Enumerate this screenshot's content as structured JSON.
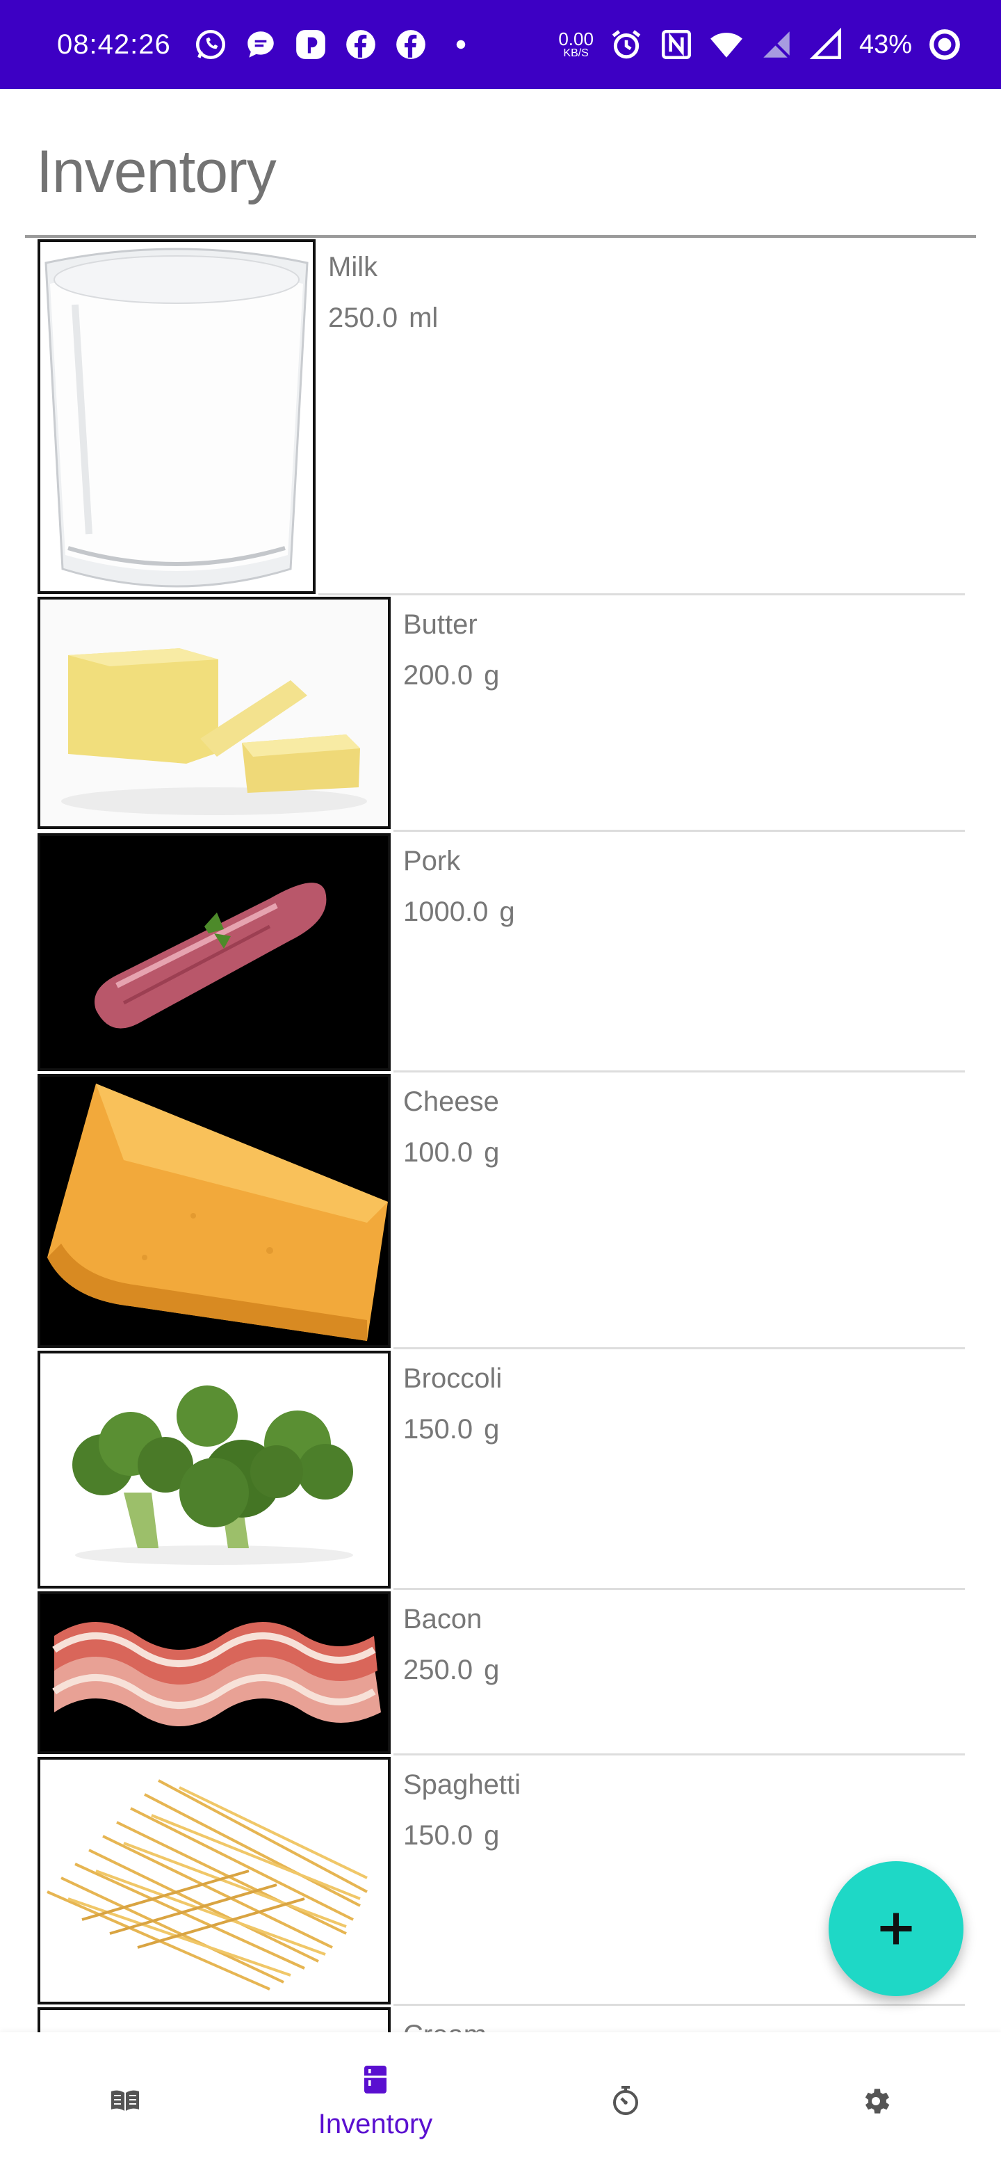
{
  "status_bar": {
    "time": "08:42:26",
    "netspeed_value": "0.00",
    "netspeed_unit": "KB/S",
    "battery_percent": "43%"
  },
  "page": {
    "title": "Inventory"
  },
  "inventory": {
    "items": [
      {
        "name": "Milk",
        "amount": "250.0",
        "unit": "ml"
      },
      {
        "name": "Butter",
        "amount": "200.0",
        "unit": "g"
      },
      {
        "name": "Pork",
        "amount": "1000.0",
        "unit": "g"
      },
      {
        "name": "Cheese",
        "amount": "100.0",
        "unit": "g"
      },
      {
        "name": "Broccoli",
        "amount": "150.0",
        "unit": "g"
      },
      {
        "name": "Bacon",
        "amount": "250.0",
        "unit": "g"
      },
      {
        "name": "Spaghetti",
        "amount": "150.0",
        "unit": "g"
      },
      {
        "name": "Cream",
        "amount": "",
        "unit": ""
      }
    ]
  },
  "fab": {
    "icon": "plus-icon",
    "color": "#1ed8c6"
  },
  "bottom_nav": {
    "items": [
      {
        "icon": "book-icon",
        "label": ""
      },
      {
        "icon": "inventory-icon",
        "label": "Inventory",
        "active": true
      },
      {
        "icon": "timer-icon",
        "label": ""
      },
      {
        "icon": "gear-icon",
        "label": ""
      }
    ]
  },
  "colors": {
    "status_bar": "#3d00c4",
    "accent": "#5a0fd0",
    "fab": "#1ed8c6"
  }
}
